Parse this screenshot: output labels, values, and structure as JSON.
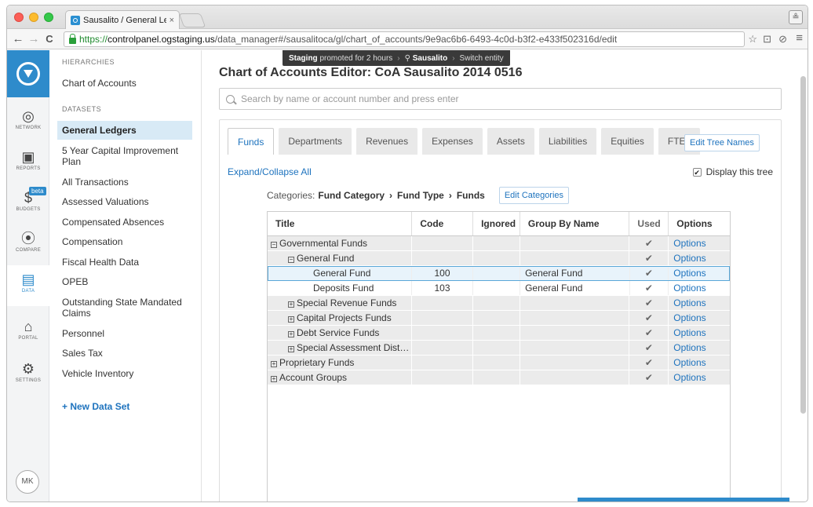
{
  "browser": {
    "tab_title": "Sausalito / General Ledger",
    "tab_close": "×",
    "url_secure": "https://",
    "url_host": "controlpanel.ogstaging.us",
    "url_path": "/data_manager#/sausalitoca/gl/chart_of_accounts/9e9ac6b6-6493-4c0d-b3f2-e433f502316d/edit",
    "back": "←",
    "forward": "→",
    "reload": "C",
    "menu": "≡",
    "star": "☆",
    "cast": "⊡",
    "ext": "⊘",
    "profile": "≗"
  },
  "rail": {
    "items": [
      {
        "label": "NETWORK",
        "icon": "◎"
      },
      {
        "label": "REPORTS",
        "icon": "▣"
      },
      {
        "label": "BUDGETS",
        "icon": "$"
      },
      {
        "label": "COMPARE",
        "icon": "⦿"
      },
      {
        "label": "DATA",
        "icon": "▤"
      },
      {
        "label": "PORTAL",
        "icon": "⌂"
      },
      {
        "label": "SETTINGS",
        "icon": "⚙"
      }
    ],
    "beta": "beta",
    "avatar": "MK"
  },
  "sidebar": {
    "hierarchies_heading": "HIERARCHIES",
    "hierarchies": [
      "Chart of Accounts"
    ],
    "datasets_heading": "DATASETS",
    "datasets": [
      "General Ledgers",
      "5 Year Capital Improvement Plan",
      "All Transactions",
      "Assessed Valuations",
      "Compensated Absences",
      "Compensation",
      "Fiscal Health Data",
      "OPEB",
      "Outstanding State Mandated Claims",
      "Personnel",
      "Sales Tax",
      "Vehicle Inventory"
    ],
    "new_dataset": "+ New Data Set"
  },
  "tooltip": {
    "staging": "Staging",
    "promoted": "promoted for 2 hours",
    "entity": "Sausalito",
    "switch": "Switch entity",
    "sep": "›"
  },
  "main": {
    "title": "Chart of Accounts Editor: CoA Sausalito 2014 0516",
    "search_placeholder": "Search by name or account number and press enter",
    "tabs": [
      "Funds",
      "Departments",
      "Revenues",
      "Expenses",
      "Assets",
      "Liabilities",
      "Equities",
      "FTEs"
    ],
    "edit_tree_names": "Edit Tree Names",
    "expand_collapse": "Expand/Collapse All",
    "display_tree": "Display this tree",
    "categories_label": "Categories:",
    "categories": [
      "Fund Category",
      "Fund Type",
      "Funds"
    ],
    "cat_arrow": "›",
    "edit_categories": "Edit Categories"
  },
  "grid": {
    "headers": [
      "Title",
      "Code",
      "Ignored",
      "Group By Name",
      "Used",
      "Options"
    ],
    "rows": [
      {
        "title": "Governmental Funds",
        "code": "",
        "group": "",
        "used": "✔",
        "options": "Options",
        "exp": "−",
        "indent": 0
      },
      {
        "title": "General Fund",
        "code": "",
        "group": "",
        "used": "✔",
        "options": "Options",
        "exp": "−",
        "indent": 1
      },
      {
        "title": "General Fund",
        "code": "100",
        "group": "General Fund",
        "used": "✔",
        "options": "Options",
        "exp": "",
        "indent": 2
      },
      {
        "title": "Deposits Fund",
        "code": "103",
        "group": "General Fund",
        "used": "✔",
        "options": "Options",
        "exp": "",
        "indent": 2
      },
      {
        "title": "Special Revenue Funds",
        "code": "",
        "group": "",
        "used": "✔",
        "options": "Options",
        "exp": "+",
        "indent": 1
      },
      {
        "title": "Capital Projects Funds",
        "code": "",
        "group": "",
        "used": "✔",
        "options": "Options",
        "exp": "+",
        "indent": 1
      },
      {
        "title": "Debt Service Funds",
        "code": "",
        "group": "",
        "used": "✔",
        "options": "Options",
        "exp": "+",
        "indent": 1
      },
      {
        "title": "Special Assessment Distric...",
        "code": "",
        "group": "",
        "used": "✔",
        "options": "Options",
        "exp": "+",
        "indent": 1
      },
      {
        "title": "Proprietary Funds",
        "code": "",
        "group": "",
        "used": "✔",
        "options": "Options",
        "exp": "+",
        "indent": 0
      },
      {
        "title": "Account Groups",
        "code": "",
        "group": "",
        "used": "✔",
        "options": "Options",
        "exp": "+",
        "indent": 0
      }
    ]
  }
}
